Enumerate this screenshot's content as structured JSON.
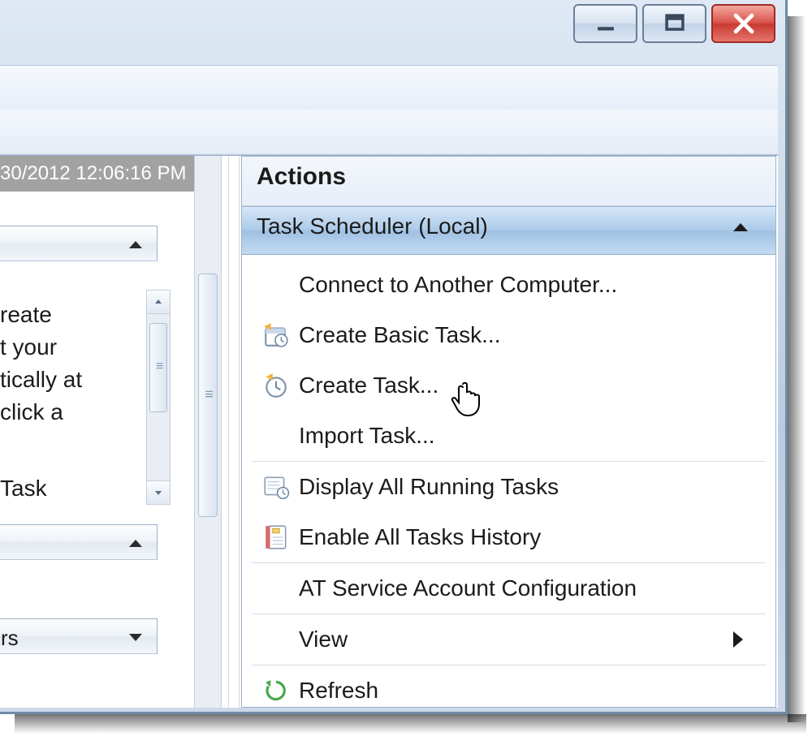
{
  "left": {
    "timestamp": "30/2012 12:06:16 PM",
    "body_line1": "reate",
    "body_line2": "t your",
    "body_line3": "tically at",
    "body_line4": " click a",
    "body_line5": "Task",
    "triggers_label": "rs"
  },
  "actions": {
    "header": "Actions",
    "scope": "Task Scheduler (Local)",
    "items": {
      "connect": "Connect to Another Computer...",
      "basic": "Create Basic Task...",
      "create": "Create Task...",
      "import": "Import Task...",
      "running": "Display All Running Tasks",
      "history": "Enable All Tasks History",
      "atservice": "AT Service Account Configuration",
      "view": "View",
      "refresh": "Refresh"
    }
  }
}
